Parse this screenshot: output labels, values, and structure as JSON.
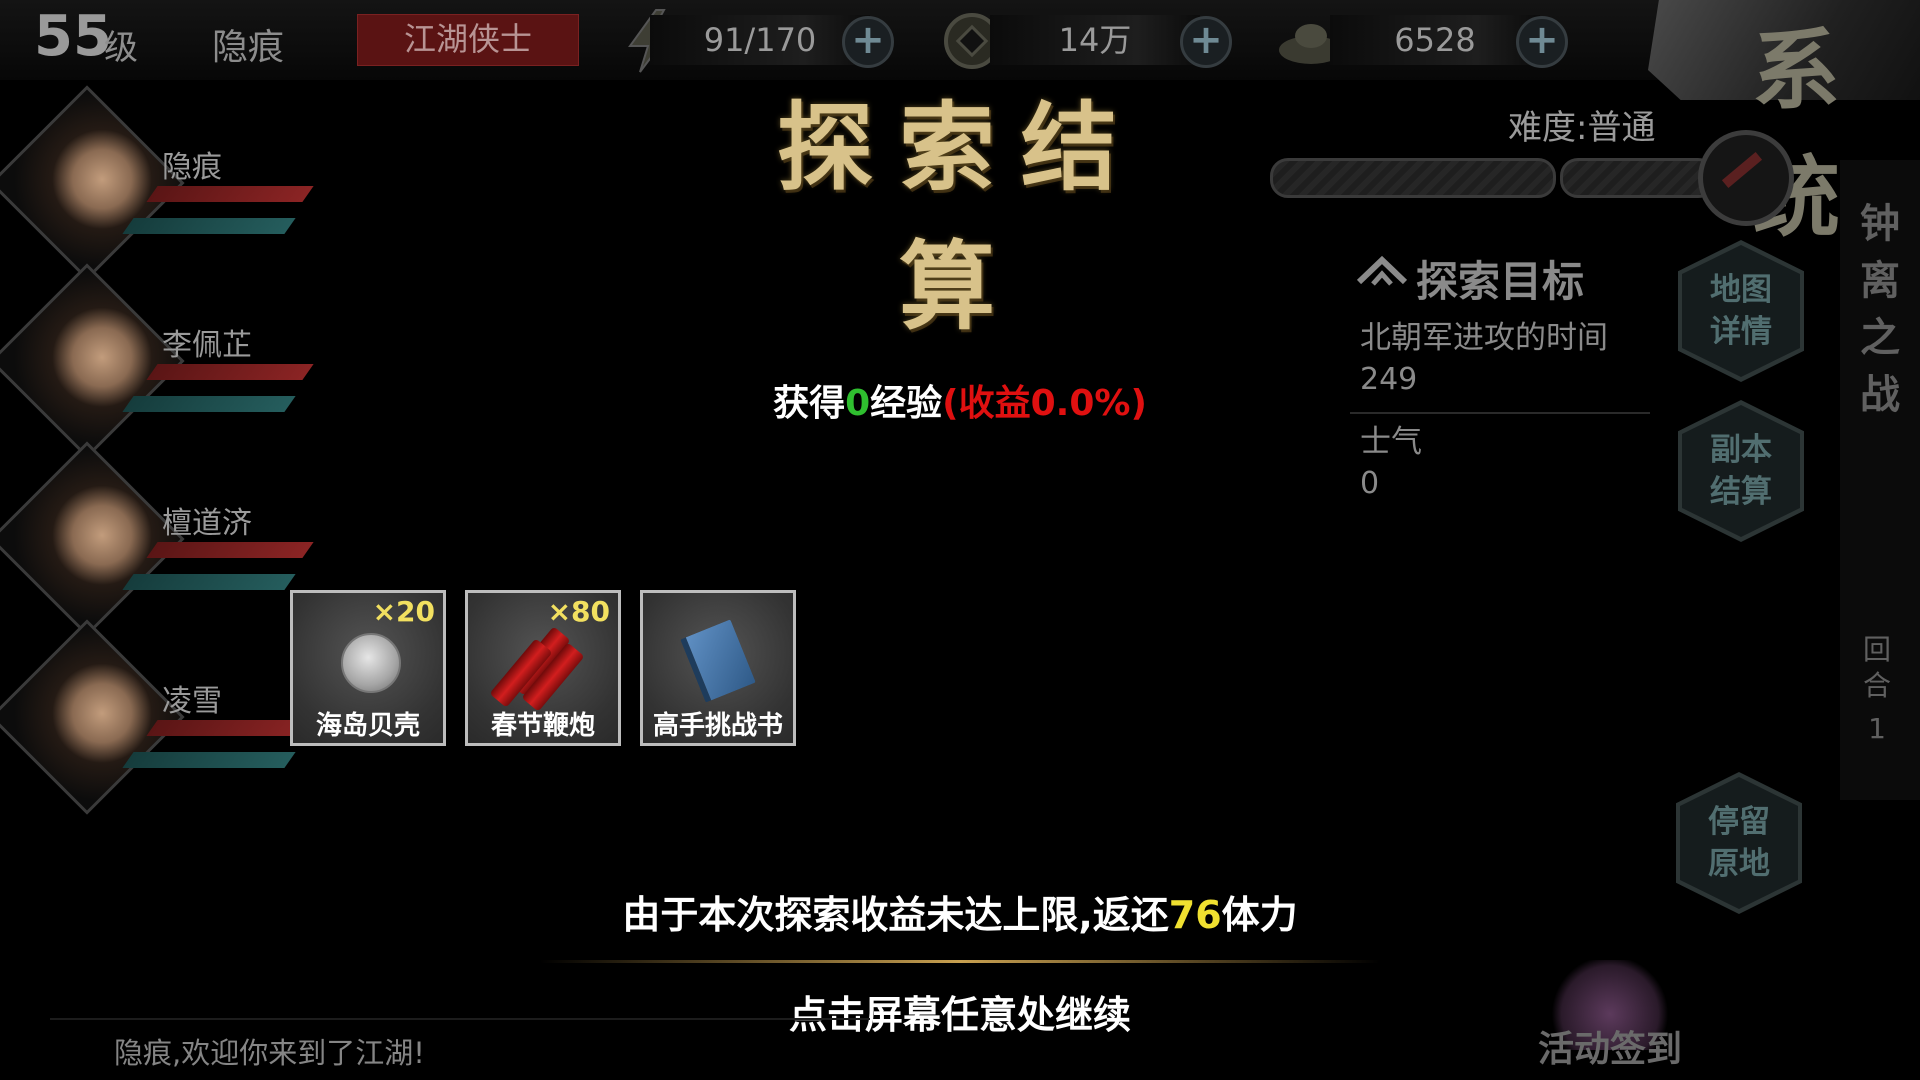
{
  "topbar": {
    "level": "55",
    "level_unit": "级",
    "player_name": "隐痕",
    "player_title": "江湖侠士",
    "stamina": "91/170",
    "coins": "14万",
    "ingots": "6528",
    "plus": "+"
  },
  "system_button": {
    "label": "系统"
  },
  "title": "探索结算",
  "difficulty": {
    "label": "难度:普通"
  },
  "party": [
    {
      "name": "隐痕",
      "hp": 1.0,
      "mp": 1.0
    },
    {
      "name": "李佩芷",
      "hp": 1.0,
      "mp": 1.0
    },
    {
      "name": "檀道济",
      "hp": 1.0,
      "mp": 1.0
    },
    {
      "name": "凌雪",
      "hp": 1.0,
      "mp": 1.0
    }
  ],
  "explore": {
    "title": "探索目标",
    "objectives": [
      {
        "label": "北朝军进攻的时间",
        "value": "249"
      },
      {
        "label": "士气",
        "value": "0"
      }
    ]
  },
  "side_buttons": {
    "map_detail": [
      "地图",
      "详情"
    ],
    "dungeon_settle": [
      "副本",
      "结算"
    ],
    "stay": [
      "停留",
      "原地"
    ]
  },
  "dungeon": {
    "name": "钟离之战",
    "round_label": "回合",
    "round": "1"
  },
  "result": {
    "exp_prefix": "获得",
    "exp_value": "0",
    "exp_suffix": "经验",
    "rate_text": "(收益0.0%)"
  },
  "items": [
    {
      "name": "海岛贝壳",
      "count": "×20",
      "icon": "shell-icon"
    },
    {
      "name": "春节鞭炮",
      "count": "×80",
      "icon": "firecracker-icon"
    },
    {
      "name": "高手挑战书",
      "count": "",
      "icon": "book-icon"
    }
  ],
  "refund": {
    "prefix": "由于本次探索收益未达上限,返还",
    "value": "76",
    "suffix": "体力"
  },
  "continue_text": "点击屏幕任意处继续",
  "chat": "隐痕,欢迎你来到了江湖!",
  "event": {
    "label": "活动签到"
  },
  "colors": {
    "accent_gold": "#d8c28a",
    "exp_green": "#2fbf2f",
    "rate_red": "#e01010",
    "refund_yellow": "#f0e030"
  }
}
